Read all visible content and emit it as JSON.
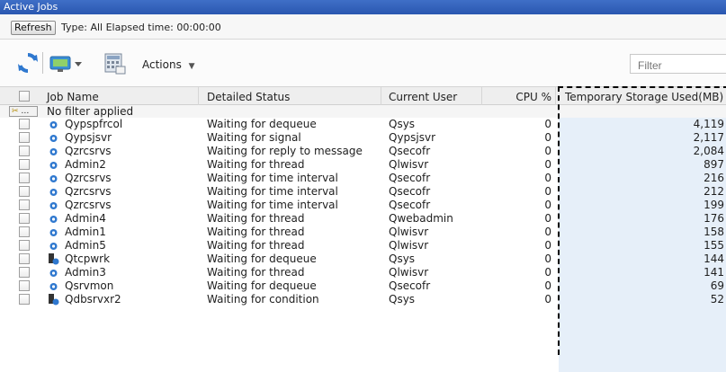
{
  "window": {
    "title": "Active Jobs"
  },
  "info": {
    "refresh_label": "Refresh",
    "text": "Type: All   Elapsed time: 00:00:00"
  },
  "toolbar": {
    "actions_label": "Actions",
    "filter_placeholder": "Filter"
  },
  "grid": {
    "columns": [
      "Job Name",
      "Detailed Status",
      "Current User",
      "CPU %",
      "Temporary Storage Used(MB)"
    ],
    "filter_text": "No filter applied",
    "filter_button": "…",
    "rows": [
      {
        "job": "Qypspfrcol",
        "status": "Waiting for dequeue",
        "user": "Qsys",
        "cpu": "0",
        "storage": "4,119",
        "icon": "job-icon"
      },
      {
        "job": "Qypsjsvr",
        "status": "Waiting for signal",
        "user": "Qypsjsvr",
        "cpu": "0",
        "storage": "2,117",
        "icon": "job-icon"
      },
      {
        "job": "Qzrcsrvs",
        "status": "Waiting for reply to message",
        "user": "Qsecofr",
        "cpu": "0",
        "storage": "2,084",
        "icon": "job-icon"
      },
      {
        "job": "Admin2",
        "status": "Waiting for thread",
        "user": "Qlwisvr",
        "cpu": "0",
        "storage": "897",
        "icon": "job-icon"
      },
      {
        "job": "Qzrcsrvs",
        "status": "Waiting for time interval",
        "user": "Qsecofr",
        "cpu": "0",
        "storage": "216",
        "icon": "job-icon"
      },
      {
        "job": "Qzrcsrvs",
        "status": "Waiting for time interval",
        "user": "Qsecofr",
        "cpu": "0",
        "storage": "212",
        "icon": "job-icon"
      },
      {
        "job": "Qzrcsrvs",
        "status": "Waiting for time interval",
        "user": "Qsecofr",
        "cpu": "0",
        "storage": "199",
        "icon": "job-icon"
      },
      {
        "job": "Admin4",
        "status": "Waiting for thread",
        "user": "Qwebadmin",
        "cpu": "0",
        "storage": "176",
        "icon": "job-icon"
      },
      {
        "job": "Admin1",
        "status": "Waiting for thread",
        "user": "Qlwisvr",
        "cpu": "0",
        "storage": "158",
        "icon": "job-icon"
      },
      {
        "job": "Admin5",
        "status": "Waiting for thread",
        "user": "Qlwisvr",
        "cpu": "0",
        "storage": "155",
        "icon": "job-icon"
      },
      {
        "job": "Qtcpwrk",
        "status": "Waiting for dequeue",
        "user": "Qsys",
        "cpu": "0",
        "storage": "144",
        "icon": "system-job-icon"
      },
      {
        "job": "Admin3",
        "status": "Waiting for thread",
        "user": "Qlwisvr",
        "cpu": "0",
        "storage": "141",
        "icon": "job-icon"
      },
      {
        "job": "Qsrvmon",
        "status": "Waiting for dequeue",
        "user": "Qsecofr",
        "cpu": "0",
        "storage": "69",
        "icon": "job-icon"
      },
      {
        "job": "Qdbsrvxr2",
        "status": "Waiting for condition",
        "user": "Qsys",
        "cpu": "0",
        "storage": "52",
        "icon": "system-job-icon"
      }
    ]
  },
  "colors": {
    "title_bar": "#2a57b0",
    "selected_column": "#e6eff9"
  }
}
